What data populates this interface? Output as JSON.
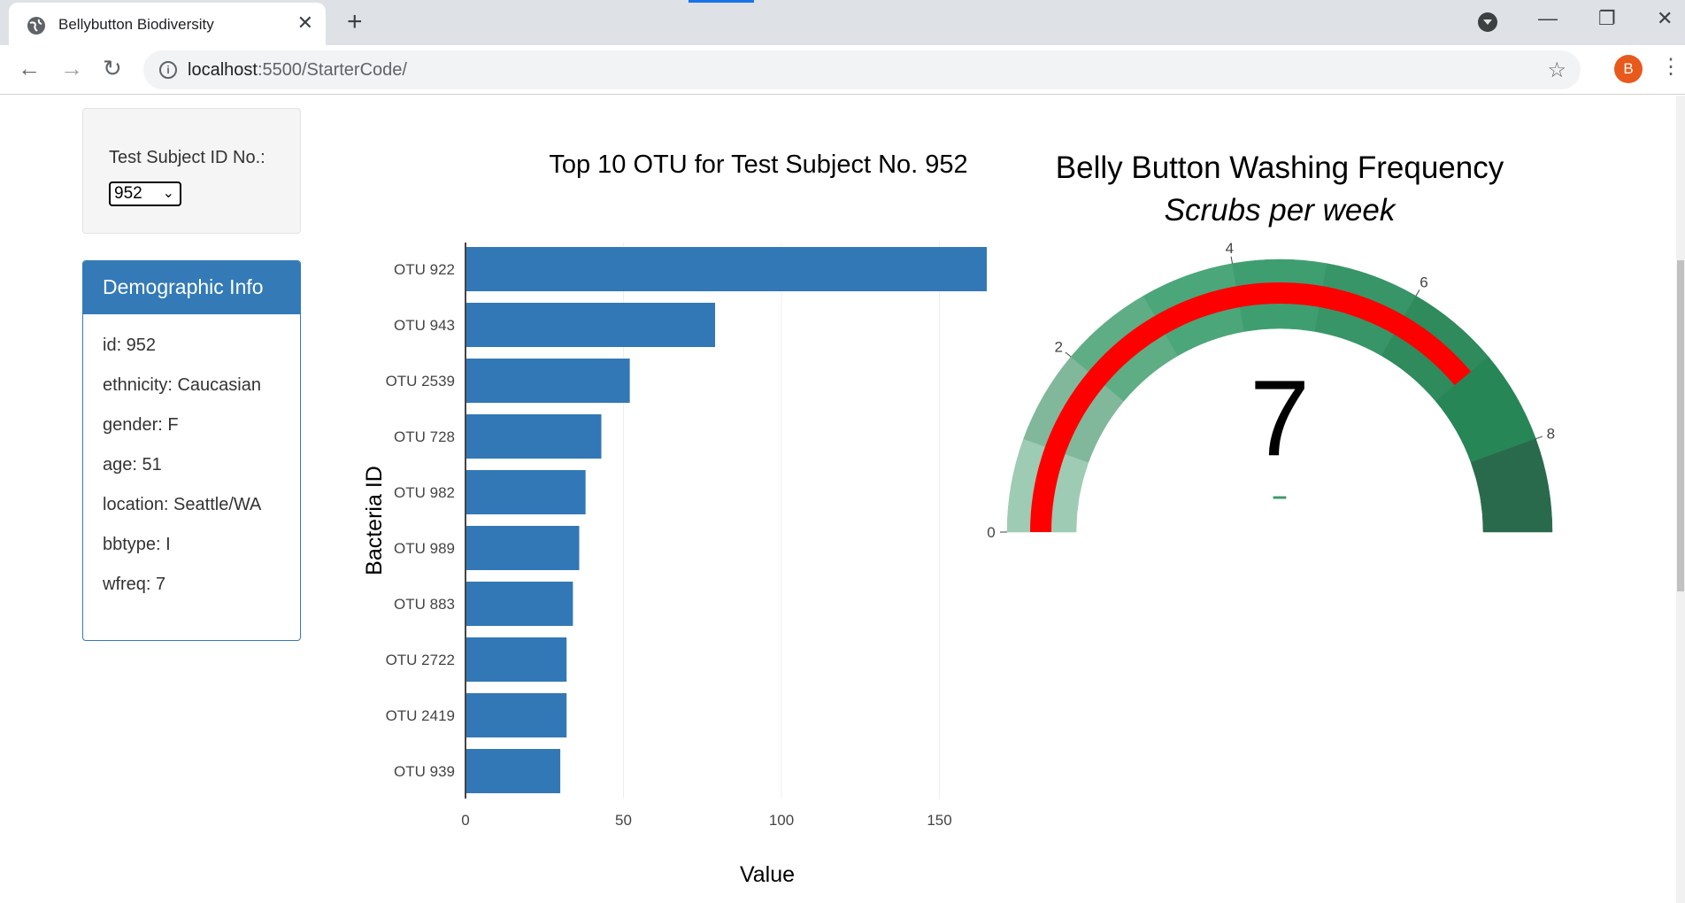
{
  "browser": {
    "tab_title": "Bellybutton Biodiversity",
    "tab_close": "✕",
    "new_tab": "+",
    "url_host": "localhost",
    "url_rest": ":5500/StarterCode/",
    "profile_initial": "B",
    "minimize": "—",
    "restore": "❐",
    "close": "✕"
  },
  "selector": {
    "label": "Test Subject ID No.:",
    "value": "952"
  },
  "demographics": {
    "heading": "Demographic Info",
    "rows": [
      "id: 952",
      "ethnicity: Caucasian",
      "gender: F",
      "age: 51",
      "location: Seattle/WA",
      "bbtype: I",
      "wfreq: 7"
    ]
  },
  "chart_data": [
    {
      "type": "bar",
      "orientation": "horizontal",
      "title": "Top 10 OTU for Test Subject No. 952",
      "xlabel": "Value",
      "ylabel": "Bacteria ID",
      "categories": [
        "OTU 922",
        "OTU 943",
        "OTU 2539",
        "OTU 728",
        "OTU 982",
        "OTU 989",
        "OTU 883",
        "OTU 2722",
        "OTU 2419",
        "OTU 939"
      ],
      "values": [
        165,
        79,
        52,
        43,
        38,
        36,
        34,
        32,
        32,
        30
      ],
      "xticks": [
        0,
        50,
        100,
        150
      ],
      "xlim": [
        0,
        165
      ],
      "color": "#3278b6",
      "grid": true
    },
    {
      "type": "gauge",
      "title": "Belly Button Washing Frequency",
      "subtitle": "Scrubs per week",
      "value": 7,
      "range": [
        0,
        9
      ],
      "ticks": [
        0,
        2,
        4,
        6,
        8
      ],
      "bar_color": "#ff0000",
      "step_colors": [
        "#9ecbb4",
        "#81b89b",
        "#5fad85",
        "#4ba67a",
        "#3f9e70",
        "#389567",
        "#2f8a5c",
        "#278656",
        "#2a6a4c"
      ],
      "delta_marker": "–"
    }
  ]
}
